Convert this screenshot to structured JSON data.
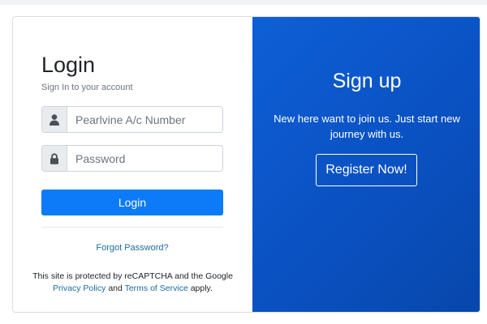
{
  "login": {
    "title": "Login",
    "subtitle": "Sign In to your account",
    "account_input": {
      "placeholder": "Pearlvine A/c Number",
      "value": "",
      "icon": "user-icon"
    },
    "password_input": {
      "placeholder": "Password",
      "value": "",
      "icon": "lock-icon"
    },
    "login_button": "Login",
    "forgot_password": "Forgot Password?",
    "recaptcha": {
      "prefix": "This site is protected by reCAPTCHA and the Google",
      "privacy_link": "Privacy Policy",
      "and": "and",
      "terms_link": "Terms of Service",
      "suffix": "apply."
    }
  },
  "signup": {
    "title": "Sign up",
    "text": "New here want to join us. Just start new journey with us.",
    "register_button": "Register Now!"
  },
  "colors": {
    "primary": "#0d7bf7",
    "panel": "#0a51c2",
    "link": "#1a6ba0"
  }
}
